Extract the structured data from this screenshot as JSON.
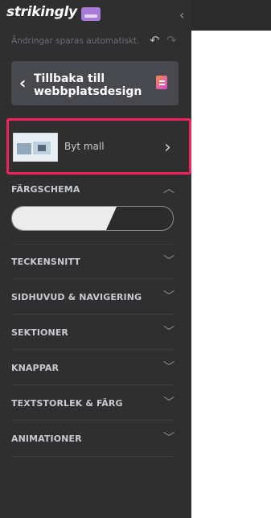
{
  "brand": {
    "name": "strikingly"
  },
  "header": {
    "autosave_text": "Ändringar sparas automatiskt.",
    "undo_icon": "undo-icon",
    "redo_icon": "redo-icon"
  },
  "back_button": {
    "label": "Tillbaka till webbplatsdesign",
    "icon": "page-icon"
  },
  "template": {
    "label": "Byt mall"
  },
  "sections": [
    {
      "label": "FÄRGSCHEMA",
      "expanded": true
    },
    {
      "label": "TECKENSNITT",
      "expanded": false
    },
    {
      "label": "SIDHUVUD & NAVIGERING",
      "expanded": false
    },
    {
      "label": "SEKTIONER",
      "expanded": false
    },
    {
      "label": "KNAPPAR",
      "expanded": false
    },
    {
      "label": "TEXTSTORLEK & FÄRG",
      "expanded": false
    },
    {
      "label": "ANIMATIONER",
      "expanded": false
    }
  ],
  "color_scheme": {
    "mode": "light",
    "light_color": "#ececec",
    "dark_color": "#2b2b2b"
  },
  "colors": {
    "accent": "#f0215b",
    "sidebar_bg": "#2f2f2f",
    "brand_badge": "#a77bd8"
  }
}
